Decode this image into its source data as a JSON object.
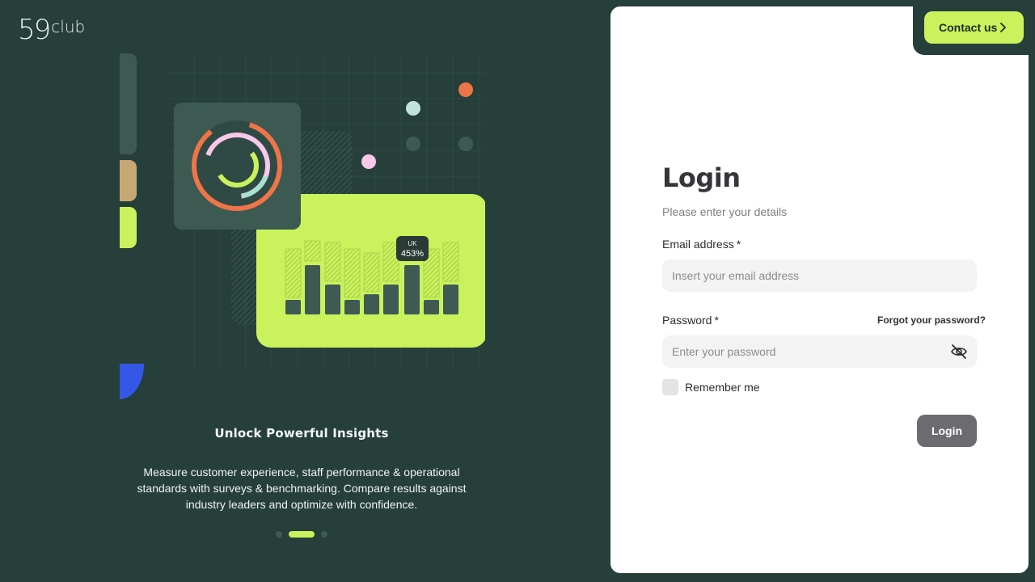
{
  "brand": {
    "logo_number": "59",
    "logo_word": "club"
  },
  "header": {
    "contact_label": "Contact us"
  },
  "illustration": {
    "badge_region": "UK",
    "badge_value": "453%"
  },
  "carousel": {
    "title": "Unlock Powerful Insights",
    "description": "Measure customer experience, staff performance & operational standards with surveys & benchmarking. Compare results against industry leaders and optimize with confidence.",
    "slide_count": 3,
    "active_index": 1
  },
  "login": {
    "title": "Login",
    "subtitle": "Please enter your details",
    "email_label": "Email address",
    "email_placeholder": "Insert your email address",
    "password_label": "Password",
    "password_placeholder": "Enter your password",
    "required_mark": "*",
    "forgot_label": "Forgot your password?",
    "remember_label": "Remember me",
    "submit_label": "Login"
  },
  "icons": {
    "contact_chevron": "chevron-right-icon",
    "password_toggle": "eye-off-icon"
  },
  "colors": {
    "background": "#263f3a",
    "accent": "#c9f25c",
    "panel": "#ffffff",
    "button": "#6c6c70",
    "orange": "#ef7448",
    "pink": "#f9c7ea",
    "blue": "#3457e8"
  }
}
